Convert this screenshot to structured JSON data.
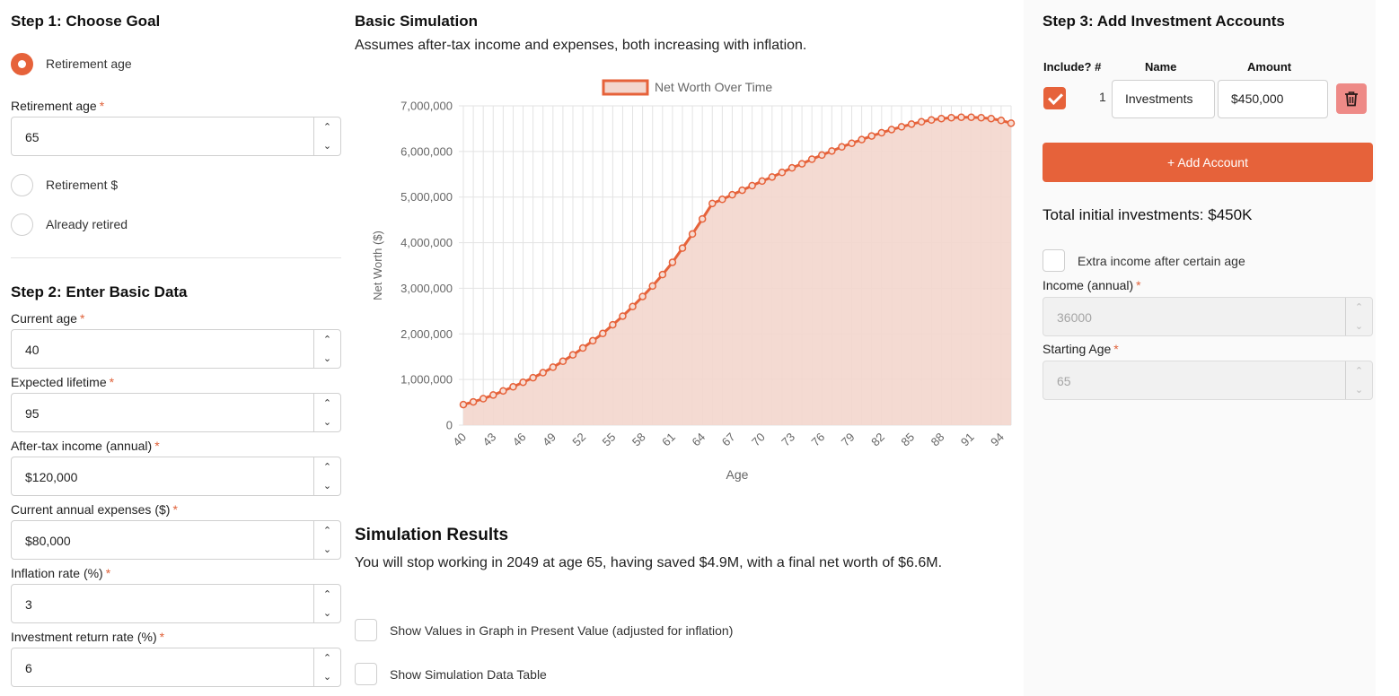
{
  "step1": {
    "title": "Step 1: Choose Goal",
    "options": [
      {
        "label": "Retirement age",
        "selected": true
      },
      {
        "label": "Retirement $",
        "selected": false
      },
      {
        "label": "Already retired",
        "selected": false
      }
    ],
    "retirement_age": {
      "label": "Retirement age",
      "required": "*",
      "value": "65"
    }
  },
  "step2": {
    "title": "Step 2: Enter Basic Data",
    "fields": [
      {
        "label": "Current age",
        "required": "*",
        "value": "40"
      },
      {
        "label": "Expected lifetime",
        "required": "*",
        "value": "95"
      },
      {
        "label": "After-tax income (annual)",
        "required": "*",
        "value": "$120,000"
      },
      {
        "label": "Current annual expenses ($)",
        "required": "*",
        "value": "$80,000"
      },
      {
        "label": "Inflation rate (%)",
        "required": "*",
        "value": "3"
      },
      {
        "label": "Investment return rate (%)",
        "required": "*",
        "value": "6"
      }
    ]
  },
  "simulation": {
    "title": "Basic Simulation",
    "subtitle": "Assumes after-tax income and expenses, both increasing with inflation."
  },
  "results": {
    "title": "Simulation Results",
    "text": "You will stop working in 2049 at age 65, having saved $4.9M, with a final net worth of $6.6M.",
    "options": [
      {
        "label": "Show Values in Graph in Present Value (adjusted for inflation)",
        "checked": false
      },
      {
        "label": "Show Simulation Data Table",
        "checked": false
      }
    ]
  },
  "step3": {
    "title": "Step 3: Add Investment Accounts",
    "columns": {
      "include": "Include?",
      "number": "#",
      "name": "Name",
      "amount": "Amount"
    },
    "accounts": [
      {
        "include": true,
        "number": "1",
        "name": "Investments",
        "amount": "$450,000"
      }
    ],
    "add_button": "+ Add Account",
    "total": "Total initial investments: $450K",
    "extra_income": {
      "label": "Extra income after certain age",
      "checked": false,
      "income_label": "Income (annual)",
      "income_value": "36000",
      "age_label": "Starting Age",
      "age_value": "65",
      "required": "*"
    }
  },
  "colors": {
    "accent": "#e6623a",
    "fill": "#f3d6cd",
    "delete": "#ee8a87"
  },
  "icons": {
    "spin_up": "chevron-up-icon",
    "spin_down": "chevron-down-icon",
    "delete": "trash-icon",
    "check": "check-icon"
  },
  "chart_data": {
    "type": "area",
    "legend": "Net Worth Over Time",
    "legend_position": "top",
    "xlabel": "Age",
    "ylabel": "Net Worth ($)",
    "ylim": [
      0,
      7000000
    ],
    "ytick_labels": [
      "0",
      "1,000,000",
      "2,000,000",
      "3,000,000",
      "4,000,000",
      "5,000,000",
      "6,000,000",
      "7,000,000"
    ],
    "xlim": [
      40,
      95
    ],
    "xtick_labels": [
      "40",
      "43",
      "46",
      "49",
      "52",
      "55",
      "58",
      "61",
      "64",
      "67",
      "70",
      "73",
      "76",
      "79",
      "82",
      "85",
      "88",
      "91",
      "94"
    ],
    "grid": true,
    "x": [
      40,
      41,
      42,
      43,
      44,
      45,
      46,
      47,
      48,
      49,
      50,
      51,
      52,
      53,
      54,
      55,
      56,
      57,
      58,
      59,
      60,
      61,
      62,
      63,
      64,
      65,
      66,
      67,
      68,
      69,
      70,
      71,
      72,
      73,
      74,
      75,
      76,
      77,
      78,
      79,
      80,
      81,
      82,
      83,
      84,
      85,
      86,
      87,
      88,
      89,
      90,
      91,
      92,
      93,
      94,
      95
    ],
    "values": [
      450000,
      510000,
      580000,
      660000,
      750000,
      840000,
      940000,
      1040000,
      1150000,
      1270000,
      1400000,
      1540000,
      1690000,
      1850000,
      2010000,
      2200000,
      2390000,
      2600000,
      2820000,
      3050000,
      3300000,
      3570000,
      3880000,
      4190000,
      4520000,
      4860000,
      4950000,
      5050000,
      5150000,
      5250000,
      5350000,
      5440000,
      5540000,
      5640000,
      5730000,
      5830000,
      5920000,
      6010000,
      6100000,
      6180000,
      6260000,
      6340000,
      6410000,
      6480000,
      6540000,
      6600000,
      6650000,
      6690000,
      6720000,
      6740000,
      6750000,
      6750000,
      6740000,
      6720000,
      6680000,
      6620000
    ]
  }
}
